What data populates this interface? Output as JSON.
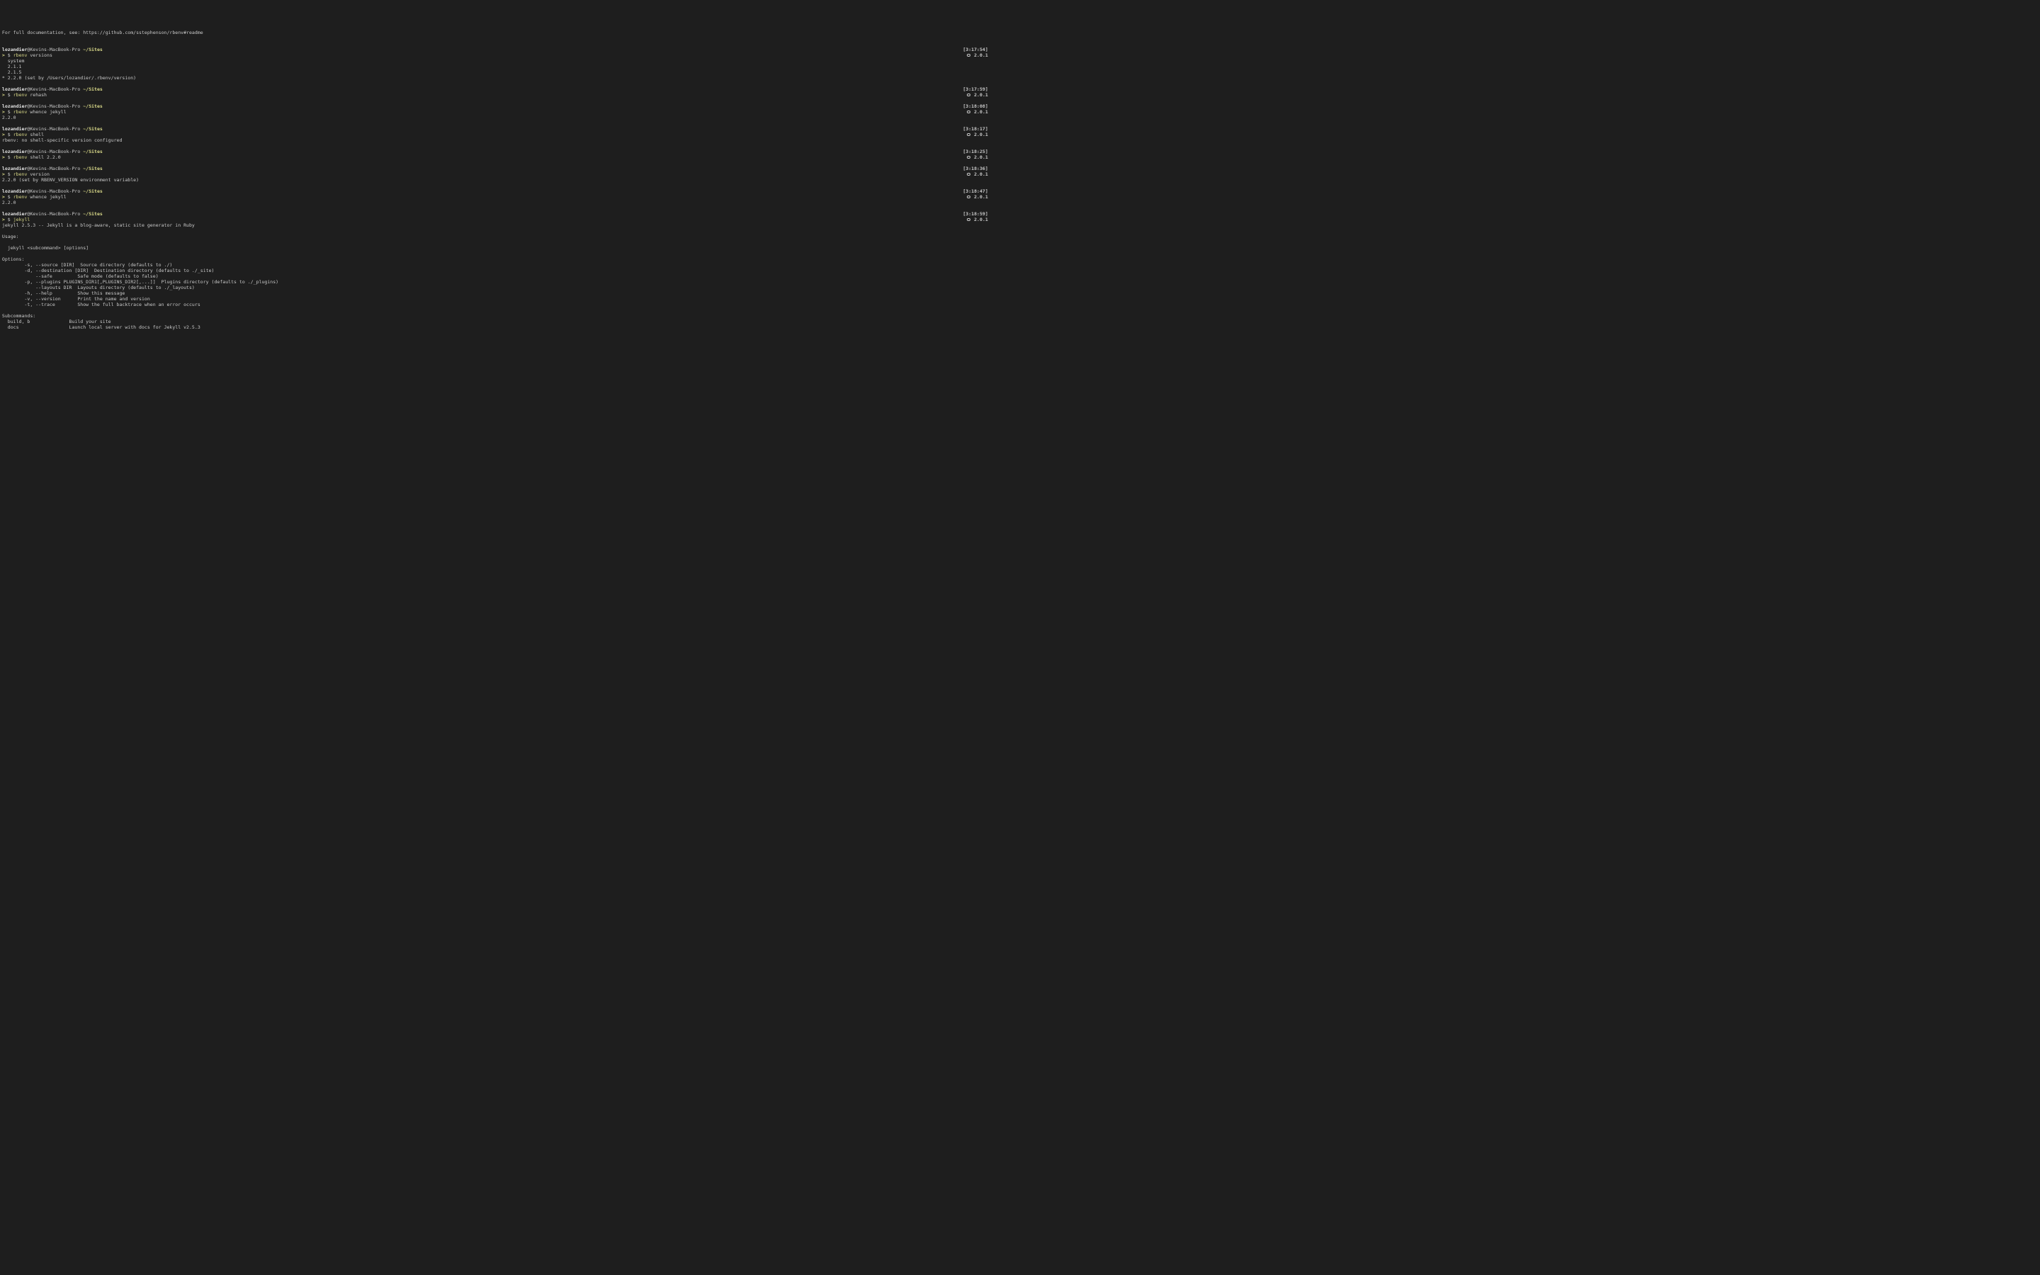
{
  "header_line": "For full documentation, see: https://github.com/sstephenson/rbenv#readme",
  "user": "lozandier",
  "host": "Kevins-MacBook-Pro",
  "path": "~/Sites",
  "arrow": ">",
  "dollar": "$",
  "ruby_version": "2.0.1",
  "blocks": [
    {
      "timestamp": "[3:17:54]",
      "cmd": "rbenv",
      "args": "versions",
      "output": "  system\n  2.1.1\n  2.1.5\n* 2.2.0 (set by /Users/lozandier/.rbenv/version)"
    },
    {
      "timestamp": "[3:17:59]",
      "cmd": "rbenv",
      "args": "rehash",
      "output": ""
    },
    {
      "timestamp": "[3:18:08]",
      "cmd": "rbenv",
      "args": "whence jekyll",
      "output": "2.2.0"
    },
    {
      "timestamp": "[3:18:17]",
      "cmd": "rbenv",
      "args": "shell",
      "output": "rbenv: no shell-specific version configured"
    },
    {
      "timestamp": "[3:18:25]",
      "cmd": "rbenv",
      "args": "shell 2.2.0",
      "output": ""
    },
    {
      "timestamp": "[3:18:36]",
      "cmd": "rbenv",
      "args": "version",
      "output": "2.2.0 (set by RBENV_VERSION environment variable)"
    },
    {
      "timestamp": "[3:18:47]",
      "cmd": "rbenv",
      "args": "whence jekyll",
      "output": "2.2.0"
    },
    {
      "timestamp": "[3:18:59]",
      "cmd": "jekyll",
      "args": "",
      "output": "jekyll 2.5.3 -- Jekyll is a blog-aware, static site generator in Ruby\n\nUsage:\n\n  jekyll <subcommand> [options]\n\nOptions:\n        -s, --source [DIR]  Source directory (defaults to ./)\n        -d, --destination [DIR]  Destination directory (defaults to ./_site)\n            --safe         Safe mode (defaults to false)\n        -p, --plugins PLUGINS_DIR1[,PLUGINS_DIR2[,...]]  Plugins directory (defaults to ./_plugins)\n            --layouts DIR  Layouts directory (defaults to ./_layouts)\n        -h, --help         Show this message\n        -v, --version      Print the name and version\n        -t, --trace        Show the full backtrace when an error occurs\n\nSubcommands:\n  build, b              Build your site\n  docs                  Launch local server with docs for Jekyll v2.5.3"
    }
  ]
}
